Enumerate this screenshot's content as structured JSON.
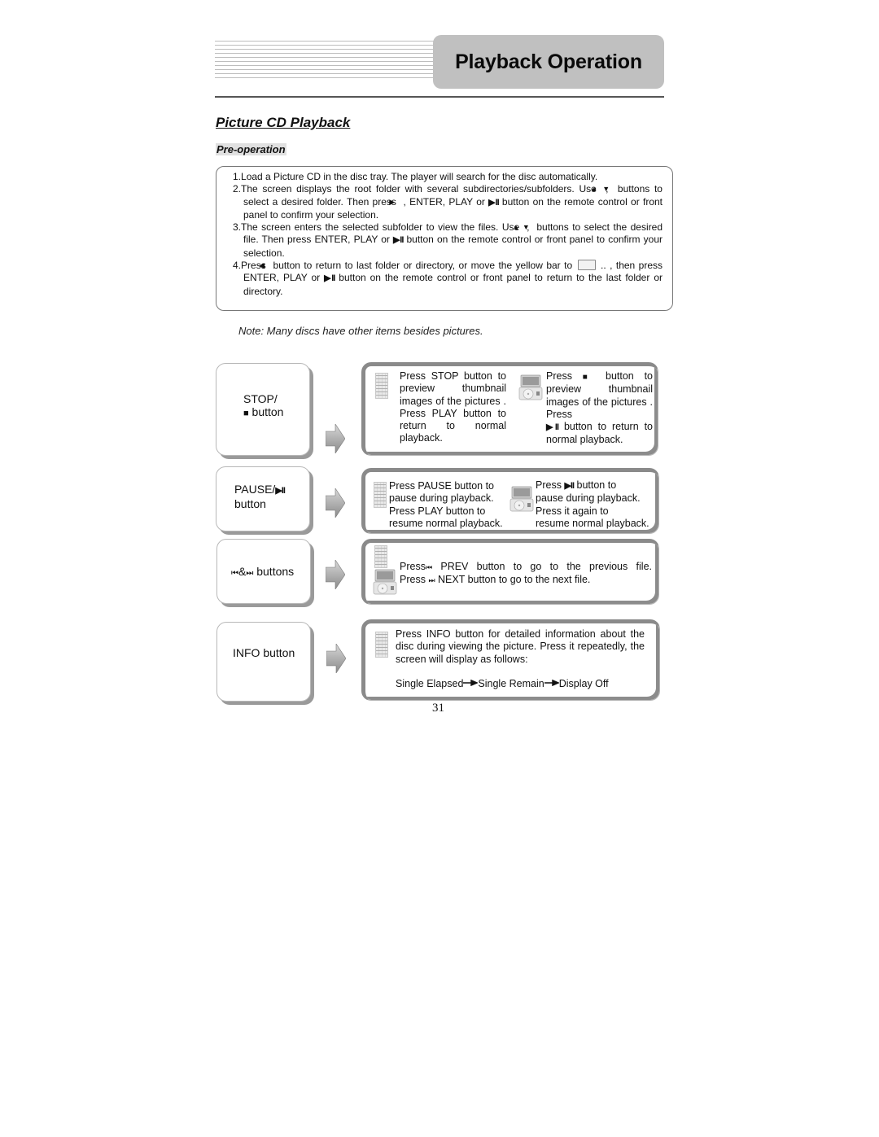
{
  "header": {
    "title": "Playback Operation"
  },
  "section": {
    "title": "Picture CD Playback",
    "subtitle": "Pre-operation"
  },
  "pre_operation": {
    "steps": [
      {
        "num": "1.",
        "parts": [
          "Load a Picture CD in the disc tray. The player will search for the disc automatically."
        ]
      },
      {
        "num": "2.",
        "parts": [
          "The screen displays the root folder with several subdirectories/subfolders. Use ",
          "▲",
          " , ",
          "▼",
          " buttons to select a desired folder. Then press ",
          "▶",
          " , ENTER, PLAY or ",
          "▶II",
          " button on the remote control or front panel to confirm your selection."
        ]
      },
      {
        "num": "3.",
        "parts": [
          "The screen enters the selected subfolder to view the files. Use ",
          "▲",
          " , ",
          "▼",
          " buttons to select the desired file. Then press ENTER, PLAY or ",
          "▶II",
          " button on the remote control or front panel to confirm your selection."
        ]
      },
      {
        "num": "4.",
        "parts": [
          "Press ",
          "◀",
          " button to return to last folder or directory, or move the yellow bar to ",
          "[folder]",
          " .. , then press ENTER, PLAY or ",
          "▶II",
          " button on the remote control or front panel to return to the last folder or directory."
        ]
      }
    ]
  },
  "note": "Note: Many discs have other items besides pictures.",
  "keys": [
    {
      "id": "stop",
      "label_line1": "STOP/",
      "label_line2_icon": "■",
      "label_line2": " button",
      "remote_text": "Press STOP button to preview thumbnail images of the pictures . Press PLAY button to return to normal playback.",
      "player_text_pre": "Press ",
      "player_icon": "■",
      "player_text_post": " button to preview thumbnail images of the pictures . Press",
      "player_text_icon2": "▶II",
      "player_text_post2": " button to return to normal playback."
    },
    {
      "id": "pause",
      "label_line1": "PAUSE/",
      "label_line1_icon": "▶II",
      "label_line2": "button",
      "remote_text_1": "Press PAUSE button to",
      "remote_text_2": "pause during playback.",
      "remote_text_3": "Press PLAY button to",
      "remote_text_4": "resume normal playback.",
      "player_text_pre": "Press ",
      "player_icon": "▶II",
      "player_text_post": " button to",
      "player_text_2": "pause during playback.",
      "player_text_3": "Press it again to",
      "player_text_4": "resume normal playback."
    },
    {
      "id": "prev-next",
      "label_icon1": "⏮",
      "label_amp": "&",
      "label_icon2": "⏭",
      "label": " buttons",
      "line1_pre": "Press",
      "line1_icon": "⏮",
      "line1_post": " PREV button to go to the previous file.",
      "line2_pre": "Press ",
      "line2_icon": "⏭",
      "line2_post": " NEXT button to go to the next file."
    },
    {
      "id": "info",
      "label": "INFO button",
      "text": "Press INFO button for detailed information about the disc during viewing the picture. Press it repeatedly, the screen will display as follows:",
      "sequence": [
        "Single Elapsed",
        "Single Remain",
        "Display Off"
      ]
    }
  ],
  "page_number": "31"
}
